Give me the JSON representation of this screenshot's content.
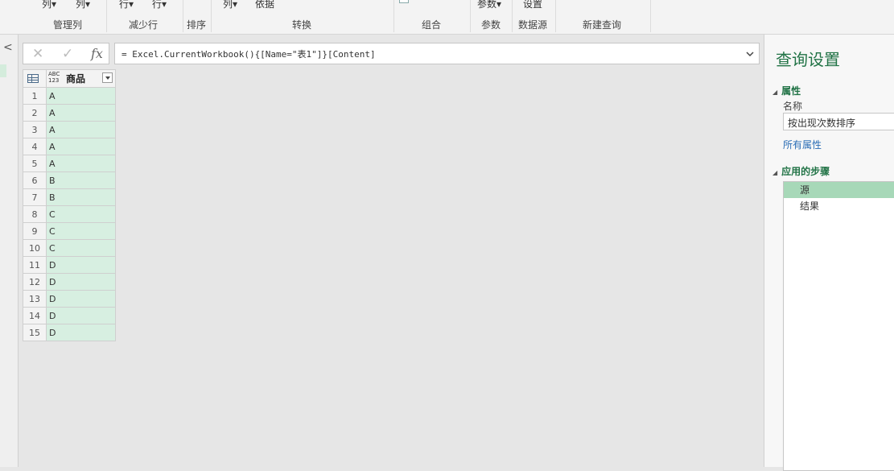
{
  "ribbon": {
    "top_items": [
      "列▾",
      "列▾",
      "行▾",
      "行▾",
      "列▾",
      "依据",
      "参数▾",
      "设置"
    ],
    "group_labels": [
      "管理列",
      "减少行",
      "排序",
      "转换",
      "组合",
      "参数",
      "数据源",
      "新建查询"
    ]
  },
  "formula_bar": {
    "formula": "= Excel.CurrentWorkbook(){[Name=\"表1\"]}[Content]",
    "fx_label": "fx"
  },
  "table": {
    "column_type": "ABC\n123",
    "column_name": "商品",
    "rows": [
      {
        "n": "1",
        "v": "A"
      },
      {
        "n": "2",
        "v": "A"
      },
      {
        "n": "3",
        "v": "A"
      },
      {
        "n": "4",
        "v": "A"
      },
      {
        "n": "5",
        "v": "A"
      },
      {
        "n": "6",
        "v": "B"
      },
      {
        "n": "7",
        "v": "B"
      },
      {
        "n": "8",
        "v": "C"
      },
      {
        "n": "9",
        "v": "C"
      },
      {
        "n": "10",
        "v": "C"
      },
      {
        "n": "11",
        "v": "D"
      },
      {
        "n": "12",
        "v": "D"
      },
      {
        "n": "13",
        "v": "D"
      },
      {
        "n": "14",
        "v": "D"
      },
      {
        "n": "15",
        "v": "D"
      }
    ]
  },
  "query_settings": {
    "title": "查询设置",
    "properties_label": "属性",
    "name_label": "名称",
    "name_value": "按出现次数排序",
    "all_properties_link": "所有属性",
    "applied_steps_label": "应用的步骤",
    "steps": [
      "源",
      "结果"
    ]
  },
  "colors": {
    "accent": "#217346",
    "cell_bg": "#d7efe1",
    "selected_step": "#a7d8b8"
  }
}
